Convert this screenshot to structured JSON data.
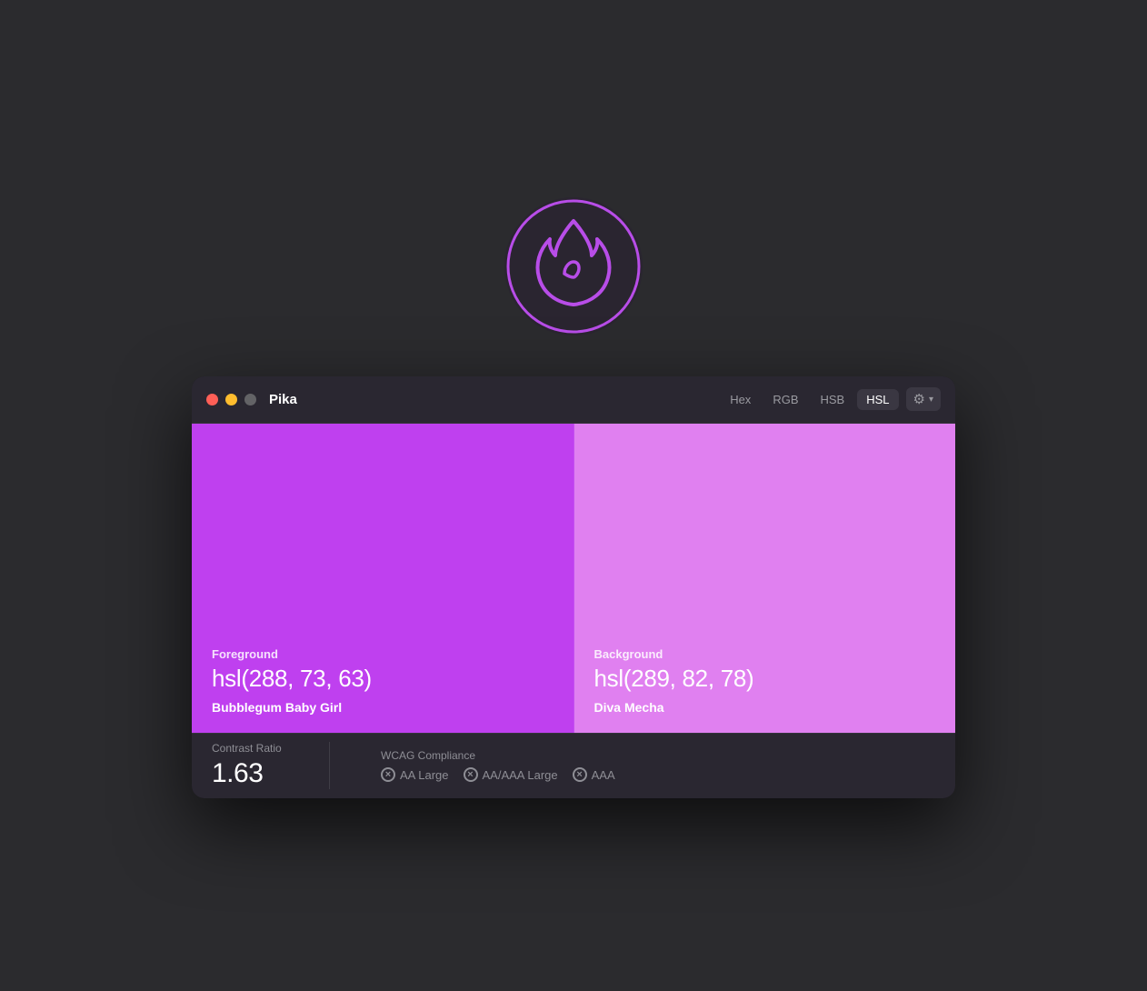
{
  "app": {
    "icon_label": "Pika flame icon",
    "title": "Pika"
  },
  "titlebar": {
    "title": "Pika",
    "format_tabs": [
      {
        "label": "Hex",
        "active": false
      },
      {
        "label": "RGB",
        "active": false
      },
      {
        "label": "HSB",
        "active": false
      },
      {
        "label": "HSL",
        "active": true
      }
    ],
    "settings_label": "⚙",
    "chevron_label": "▾"
  },
  "foreground": {
    "label": "Foreground",
    "value": "hsl(288, 73, 63)",
    "name": "Bubblegum Baby Girl",
    "color": "#bf40ef"
  },
  "background": {
    "label": "Background",
    "value": "hsl(289, 82, 78)",
    "name": "Diva Mecha",
    "color": "#e080f0"
  },
  "contrast": {
    "label": "Contrast Ratio",
    "value": "1.63"
  },
  "wcag": {
    "label": "WCAG Compliance",
    "badges": [
      {
        "label": "AA Large"
      },
      {
        "label": "AA/AAA Large"
      },
      {
        "label": "AAA"
      }
    ]
  }
}
